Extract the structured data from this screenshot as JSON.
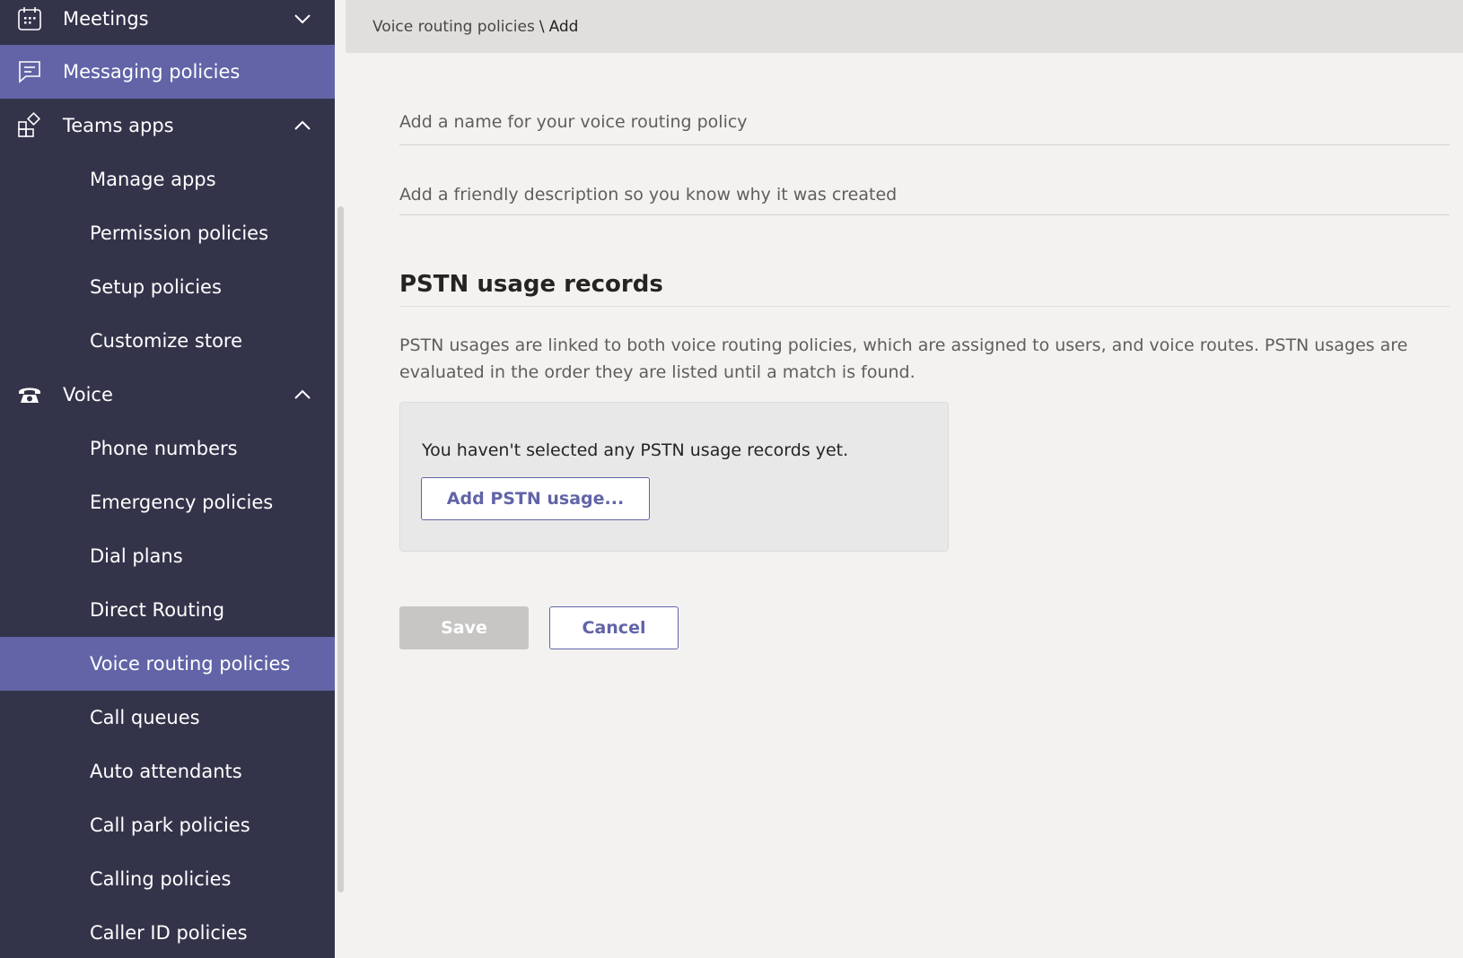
{
  "sidebar": {
    "items": [
      {
        "label": "Meetings",
        "icon": "calendar-icon",
        "chevron": "down"
      },
      {
        "label": "Messaging policies",
        "icon": "messaging-icon",
        "active": true
      },
      {
        "label": "Teams apps",
        "icon": "apps-icon",
        "chevron": "up"
      },
      {
        "label": "Manage apps"
      },
      {
        "label": "Permission policies"
      },
      {
        "label": "Setup policies"
      },
      {
        "label": "Customize store"
      },
      {
        "label": "Voice",
        "icon": "phone-icon",
        "chevron": "up"
      },
      {
        "label": "Phone numbers"
      },
      {
        "label": "Emergency policies"
      },
      {
        "label": "Dial plans"
      },
      {
        "label": "Direct Routing"
      },
      {
        "label": "Voice routing policies",
        "active": true
      },
      {
        "label": "Call queues"
      },
      {
        "label": "Auto attendants"
      },
      {
        "label": "Call park policies"
      },
      {
        "label": "Calling policies"
      },
      {
        "label": "Caller ID policies"
      }
    ]
  },
  "breadcrumb": {
    "parent": "Voice routing policies",
    "separator": "\\",
    "current": "Add"
  },
  "form": {
    "name_placeholder": "Add a name for your voice routing policy",
    "name_value": "",
    "description_placeholder": "Add a friendly description so you know why it was created",
    "description_value": ""
  },
  "pstn": {
    "title": "PSTN usage records",
    "description": "PSTN usages are linked to both voice routing policies, which are assigned to users, and voice routes. PSTN usages are evaluated in the order they are listed until a match is found.",
    "empty_message": "You haven't selected any PSTN usage records yet.",
    "add_button": "Add PSTN usage..."
  },
  "actions": {
    "save": "Save",
    "cancel": "Cancel"
  },
  "colors": {
    "sidebar_bg": "#33344a",
    "accent": "#6264a7",
    "page_bg": "#f3f2f1"
  }
}
